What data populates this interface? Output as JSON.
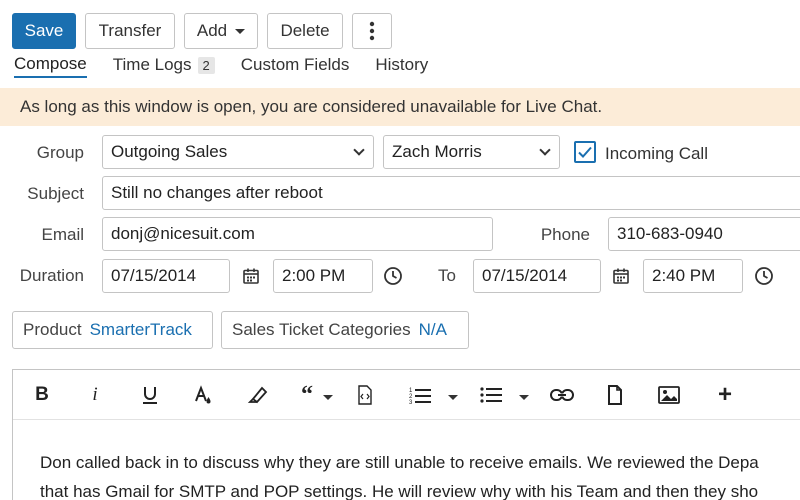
{
  "toolbar": {
    "save_label": "Save",
    "transfer_label": "Transfer",
    "add_label": "Add",
    "delete_label": "Delete"
  },
  "tabs": [
    {
      "label": "Compose",
      "active": true
    },
    {
      "label": "Time Logs",
      "count": "2"
    },
    {
      "label": "Custom Fields"
    },
    {
      "label": "History"
    }
  ],
  "banner": {
    "text": "As long as this window is open, you are considered unavailable for Live Chat."
  },
  "form": {
    "group_label": "Group",
    "group_value": "Outgoing Sales",
    "agent_value": "Zach Morris",
    "incoming_call_label": "Incoming Call",
    "incoming_call_checked": true,
    "subject_label": "Subject",
    "subject_value": "Still no changes after reboot",
    "email_label": "Email",
    "email_value": "donj@nicesuit.com",
    "phone_label": "Phone",
    "phone_value": "310-683-0940",
    "duration_label": "Duration",
    "start_date": "07/15/2014",
    "start_time": "2:00 PM",
    "to_label": "To",
    "end_date": "07/15/2014",
    "end_time": "2:40 PM"
  },
  "pills": {
    "product_label": "Product",
    "product_value": "SmarterTrack",
    "categories_label": "Sales Ticket Categories",
    "categories_value": "N/A"
  },
  "editor": {
    "toolbar_icons": [
      "bold-icon",
      "italic-icon",
      "underline-icon",
      "font-color-icon",
      "highlighter-icon",
      "quote-icon",
      "code-file-icon",
      "ordered-list-icon",
      "bullet-list-icon",
      "link-icon",
      "document-icon",
      "image-icon",
      "plus-icon"
    ],
    "body_lines": [
      "Don called back in to discuss why they are still unable to receive emails. We reviewed the Depa",
      "that has Gmail for SMTP and POP settings. He will review why with his Team and then they sho"
    ]
  },
  "colors": {
    "accent": "#1a6fb0",
    "banner_bg": "#fcecd8",
    "border": "#c4c4c4"
  }
}
